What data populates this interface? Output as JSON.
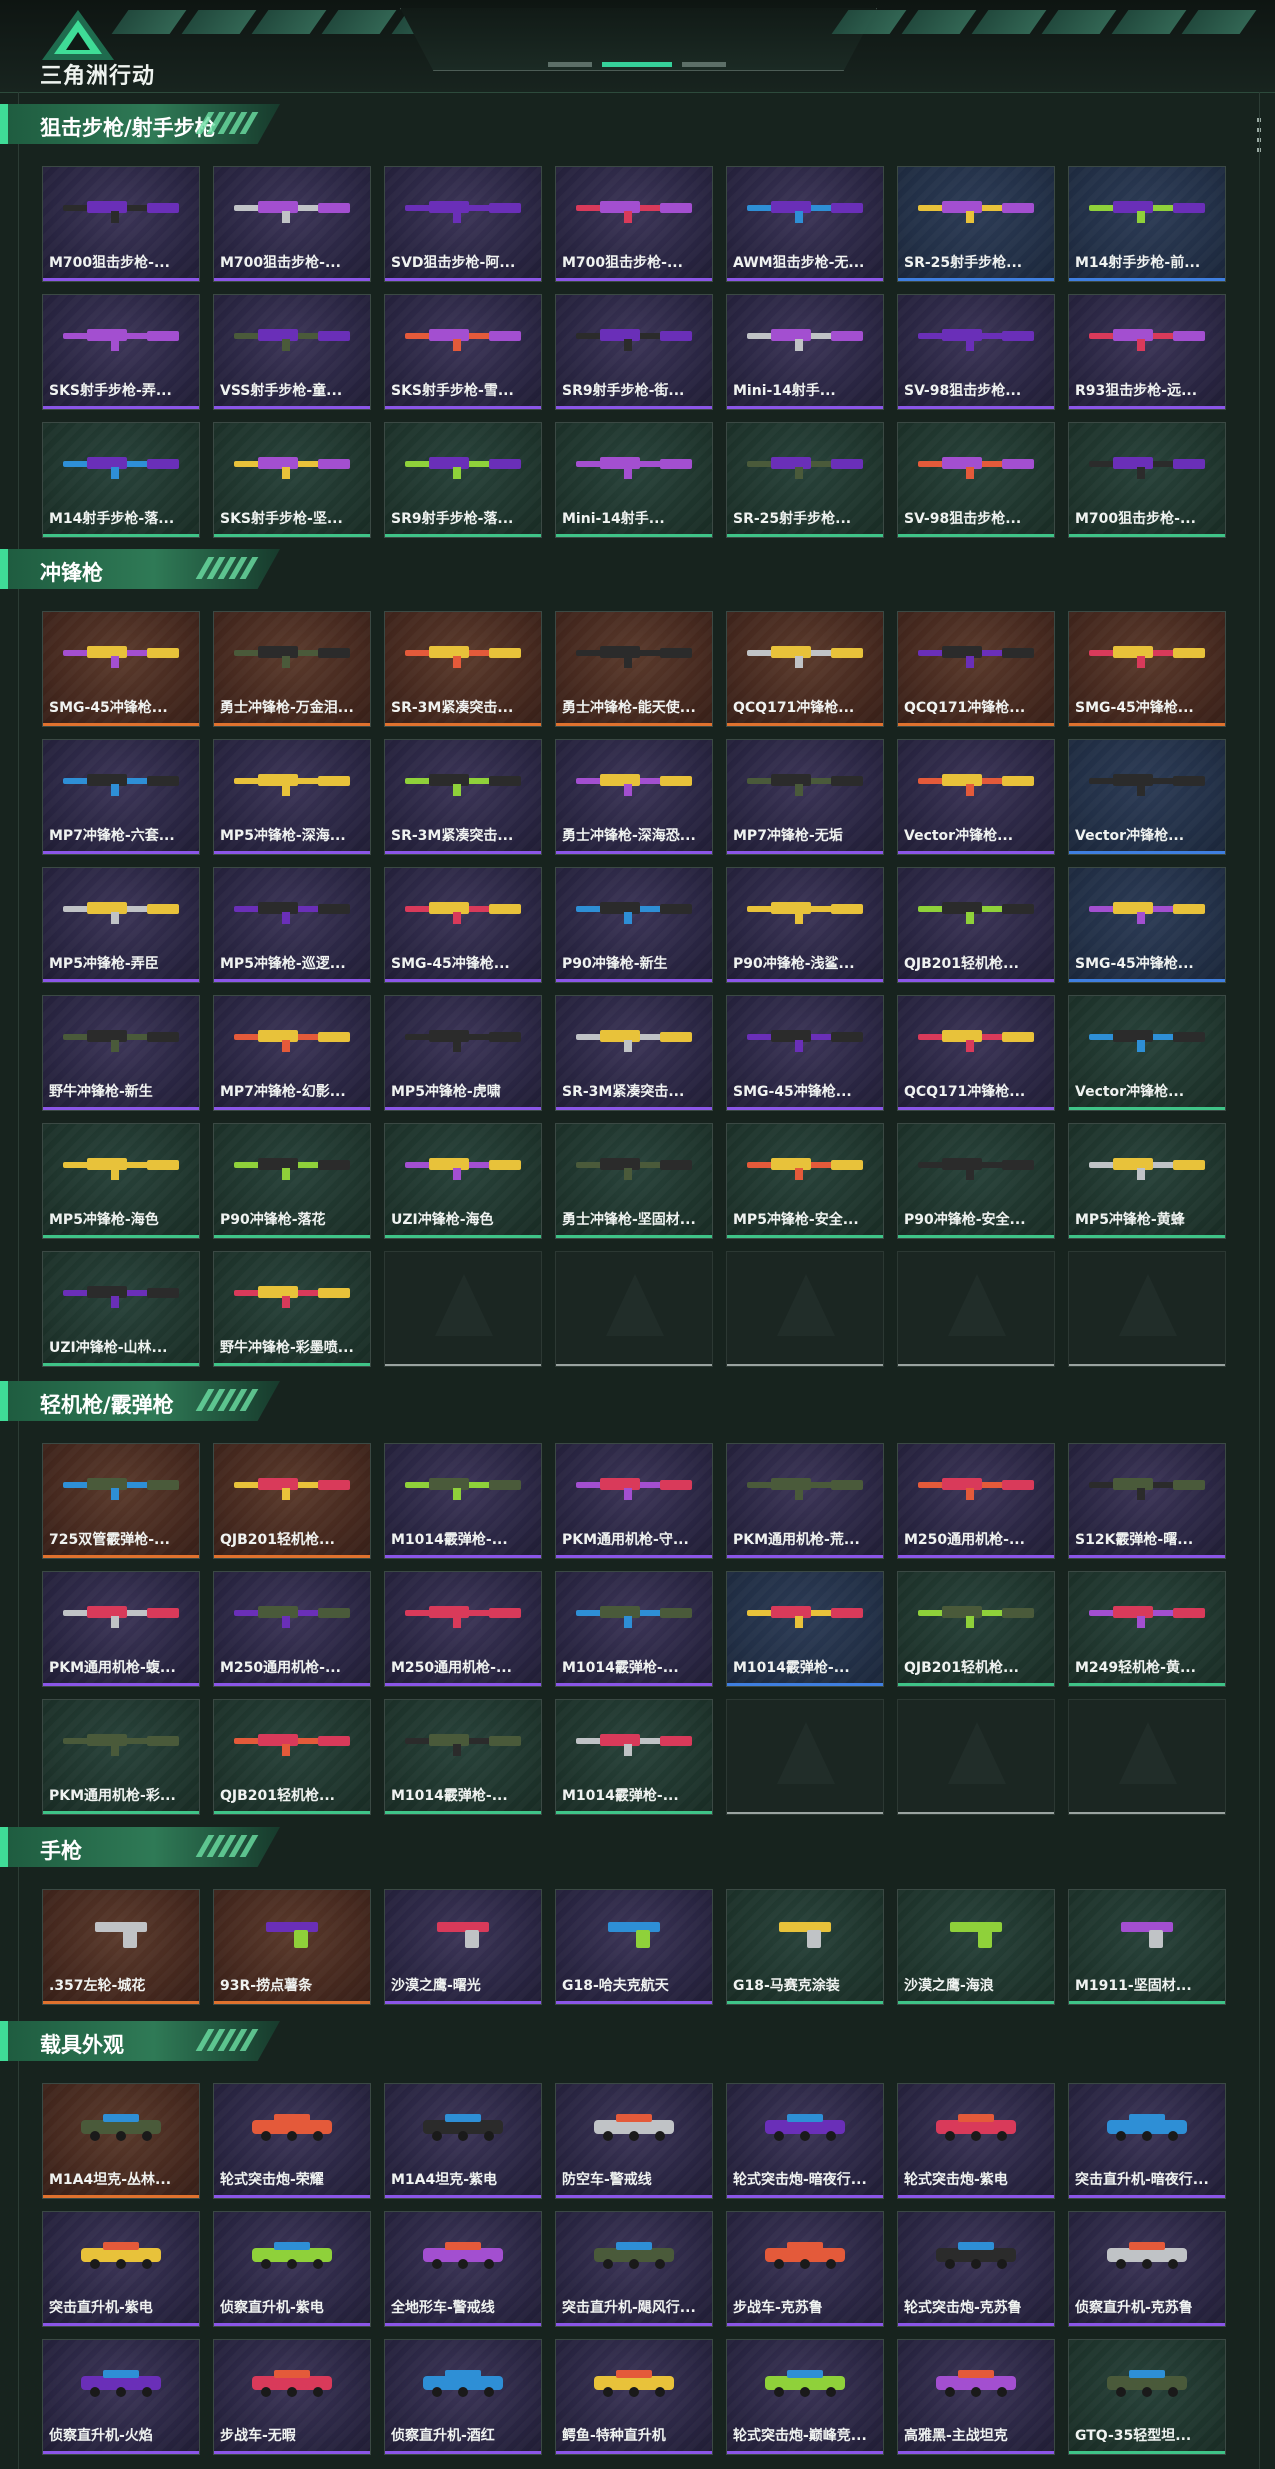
{
  "header": {
    "brand": "三角洲行动",
    "logo": "delta-triangle-logo"
  },
  "colors": {
    "purple": "#8b56e8",
    "orange": "#e0722e",
    "blue": "#3f7fe0",
    "green": "#3fc488",
    "accent": "#3fdc97"
  },
  "sections": [
    {
      "title": "狙击步枪/射手步枪",
      "items": [
        {
          "name": "M700狙击步枪-...",
          "rarity": "purple"
        },
        {
          "name": "M700狙击步枪-...",
          "rarity": "purple"
        },
        {
          "name": "SVD狙击步枪-阿...",
          "rarity": "purple"
        },
        {
          "name": "M700狙击步枪-...",
          "rarity": "purple"
        },
        {
          "name": "AWM狙击步枪-无...",
          "rarity": "purple"
        },
        {
          "name": "SR-25射手步枪...",
          "rarity": "blue"
        },
        {
          "name": "M14射手步枪-前...",
          "rarity": "blue"
        },
        {
          "name": "SKS射手步枪-弄...",
          "rarity": "purple"
        },
        {
          "name": "VSS射手步枪-童...",
          "rarity": "purple"
        },
        {
          "name": "SKS射手步枪-雪...",
          "rarity": "purple"
        },
        {
          "name": "SR9射手步枪-街...",
          "rarity": "purple"
        },
        {
          "name": "Mini-14射手...",
          "rarity": "purple"
        },
        {
          "name": "SV-98狙击步枪...",
          "rarity": "purple"
        },
        {
          "name": "R93狙击步枪-远...",
          "rarity": "purple"
        },
        {
          "name": "M14射手步枪-落...",
          "rarity": "green"
        },
        {
          "name": "SKS射手步枪-坚...",
          "rarity": "green"
        },
        {
          "name": "SR9射手步枪-落...",
          "rarity": "green"
        },
        {
          "name": "Mini-14射手...",
          "rarity": "green"
        },
        {
          "name": "SR-25射手步枪...",
          "rarity": "green"
        },
        {
          "name": "SV-98狙击步枪...",
          "rarity": "green"
        },
        {
          "name": "M700狙击步枪-...",
          "rarity": "green"
        }
      ]
    },
    {
      "title": "冲锋枪",
      "items": [
        {
          "name": "SMG-45冲锋枪...",
          "rarity": "orange"
        },
        {
          "name": "勇士冲锋枪-万金泪...",
          "rarity": "orange"
        },
        {
          "name": "SR-3M紧凑突击...",
          "rarity": "orange"
        },
        {
          "name": "勇士冲锋枪-能天使...",
          "rarity": "orange"
        },
        {
          "name": "QCQ171冲锋枪...",
          "rarity": "orange"
        },
        {
          "name": "QCQ171冲锋枪...",
          "rarity": "orange"
        },
        {
          "name": "SMG-45冲锋枪...",
          "rarity": "orange"
        },
        {
          "name": "MP7冲锋枪-六套...",
          "rarity": "purple"
        },
        {
          "name": "MP5冲锋枪-深海...",
          "rarity": "purple"
        },
        {
          "name": "SR-3M紧凑突击...",
          "rarity": "purple"
        },
        {
          "name": "勇士冲锋枪-深海恐...",
          "rarity": "purple"
        },
        {
          "name": "MP7冲锋枪-无垢",
          "rarity": "purple"
        },
        {
          "name": "Vector冲锋枪...",
          "rarity": "purple"
        },
        {
          "name": "Vector冲锋枪...",
          "rarity": "blue"
        },
        {
          "name": "MP5冲锋枪-弄臣",
          "rarity": "purple"
        },
        {
          "name": "MP5冲锋枪-巡逻...",
          "rarity": "purple"
        },
        {
          "name": "SMG-45冲锋枪...",
          "rarity": "purple"
        },
        {
          "name": "P90冲锋枪-新生",
          "rarity": "purple"
        },
        {
          "name": "P90冲锋枪-浅鲨...",
          "rarity": "purple"
        },
        {
          "name": "QJB201轻机枪...",
          "rarity": "purple"
        },
        {
          "name": "SMG-45冲锋枪...",
          "rarity": "blue"
        },
        {
          "name": "野牛冲锋枪-新生",
          "rarity": "purple"
        },
        {
          "name": "MP7冲锋枪-幻影...",
          "rarity": "purple"
        },
        {
          "name": "MP5冲锋枪-虎啸",
          "rarity": "purple"
        },
        {
          "name": "SR-3M紧凑突击...",
          "rarity": "purple"
        },
        {
          "name": "SMG-45冲锋枪...",
          "rarity": "purple"
        },
        {
          "name": "QCQ171冲锋枪...",
          "rarity": "purple"
        },
        {
          "name": "Vector冲锋枪...",
          "rarity": "green"
        },
        {
          "name": "MP5冲锋枪-海色",
          "rarity": "green"
        },
        {
          "name": "P90冲锋枪-落花",
          "rarity": "green"
        },
        {
          "name": "UZI冲锋枪-海色",
          "rarity": "green"
        },
        {
          "name": "勇士冲锋枪-坚固材...",
          "rarity": "green"
        },
        {
          "name": "MP5冲锋枪-安全...",
          "rarity": "green"
        },
        {
          "name": "P90冲锋枪-安全...",
          "rarity": "green"
        },
        {
          "name": "MP5冲锋枪-黄蜂",
          "rarity": "green"
        },
        {
          "name": "UZI冲锋枪-山林...",
          "rarity": "green"
        },
        {
          "name": "野牛冲锋枪-彩墨喷...",
          "rarity": "green"
        },
        {
          "name": "",
          "rarity": "empty"
        },
        {
          "name": "",
          "rarity": "empty"
        },
        {
          "name": "",
          "rarity": "empty"
        },
        {
          "name": "",
          "rarity": "empty"
        },
        {
          "name": "",
          "rarity": "empty"
        }
      ]
    },
    {
      "title": "轻机枪/霰弹枪",
      "items": [
        {
          "name": "725双管霰弹枪-...",
          "rarity": "orange"
        },
        {
          "name": "QJB201轻机枪...",
          "rarity": "orange"
        },
        {
          "name": "M1014霰弹枪-...",
          "rarity": "purple"
        },
        {
          "name": "PKM通用机枪-守...",
          "rarity": "purple"
        },
        {
          "name": "PKM通用机枪-荒...",
          "rarity": "purple"
        },
        {
          "name": "M250通用机枪-...",
          "rarity": "purple"
        },
        {
          "name": "S12K霰弹枪-曙...",
          "rarity": "purple"
        },
        {
          "name": "PKM通用机枪-蝮...",
          "rarity": "purple"
        },
        {
          "name": "M250通用机枪-...",
          "rarity": "purple"
        },
        {
          "name": "M250通用机枪-...",
          "rarity": "purple"
        },
        {
          "name": "M1014霰弹枪-...",
          "rarity": "purple"
        },
        {
          "name": "M1014霰弹枪-...",
          "rarity": "blue"
        },
        {
          "name": "QJB201轻机枪...",
          "rarity": "green"
        },
        {
          "name": "M249轻机枪-黄...",
          "rarity": "green"
        },
        {
          "name": "PKM通用机枪-彩...",
          "rarity": "green"
        },
        {
          "name": "QJB201轻机枪...",
          "rarity": "green"
        },
        {
          "name": "M1014霰弹枪-...",
          "rarity": "green"
        },
        {
          "name": "M1014霰弹枪-...",
          "rarity": "green"
        },
        {
          "name": "",
          "rarity": "empty"
        },
        {
          "name": "",
          "rarity": "empty"
        },
        {
          "name": "",
          "rarity": "empty"
        }
      ]
    },
    {
      "title": "手枪",
      "items": [
        {
          "name": ".357左轮-城花",
          "rarity": "orange"
        },
        {
          "name": "93R-捞点薯条",
          "rarity": "orange"
        },
        {
          "name": "沙漠之鹰-曙光",
          "rarity": "purple"
        },
        {
          "name": "G18-哈夫克航天",
          "rarity": "purple"
        },
        {
          "name": "G18-马赛克涂装",
          "rarity": "green"
        },
        {
          "name": "沙漠之鹰-海浪",
          "rarity": "green"
        },
        {
          "name": "M1911-坚固材...",
          "rarity": "green"
        }
      ]
    },
    {
      "title": "载具外观",
      "items": [
        {
          "name": "M1A4坦克-丛林...",
          "rarity": "orange"
        },
        {
          "name": "轮式突击炮-荣耀",
          "rarity": "purple"
        },
        {
          "name": "M1A4坦克-紫电",
          "rarity": "purple"
        },
        {
          "name": "防空车-警戒线",
          "rarity": "purple"
        },
        {
          "name": "轮式突击炮-暗夜行...",
          "rarity": "purple"
        },
        {
          "name": "轮式突击炮-紫电",
          "rarity": "purple"
        },
        {
          "name": "突击直升机-暗夜行...",
          "rarity": "purple"
        },
        {
          "name": "突击直升机-紫电",
          "rarity": "purple"
        },
        {
          "name": "侦察直升机-紫电",
          "rarity": "purple"
        },
        {
          "name": "全地形车-警戒线",
          "rarity": "purple"
        },
        {
          "name": "突击直升机-飓风行...",
          "rarity": "purple"
        },
        {
          "name": "步战车-克苏鲁",
          "rarity": "purple"
        },
        {
          "name": "轮式突击炮-克苏鲁",
          "rarity": "purple"
        },
        {
          "name": "侦察直升机-克苏鲁",
          "rarity": "purple"
        },
        {
          "name": "侦察直升机-火焰",
          "rarity": "purple"
        },
        {
          "name": "步战车-无暇",
          "rarity": "purple"
        },
        {
          "name": "侦察直升机-酒红",
          "rarity": "purple"
        },
        {
          "name": "鳄鱼-特种直升机",
          "rarity": "purple"
        },
        {
          "name": "轮式突击炮-巅峰竞...",
          "rarity": "purple"
        },
        {
          "name": "高雅黑-主战坦克",
          "rarity": "purple"
        },
        {
          "name": "GTQ-35轻型坦...",
          "rarity": "green"
        }
      ]
    }
  ]
}
